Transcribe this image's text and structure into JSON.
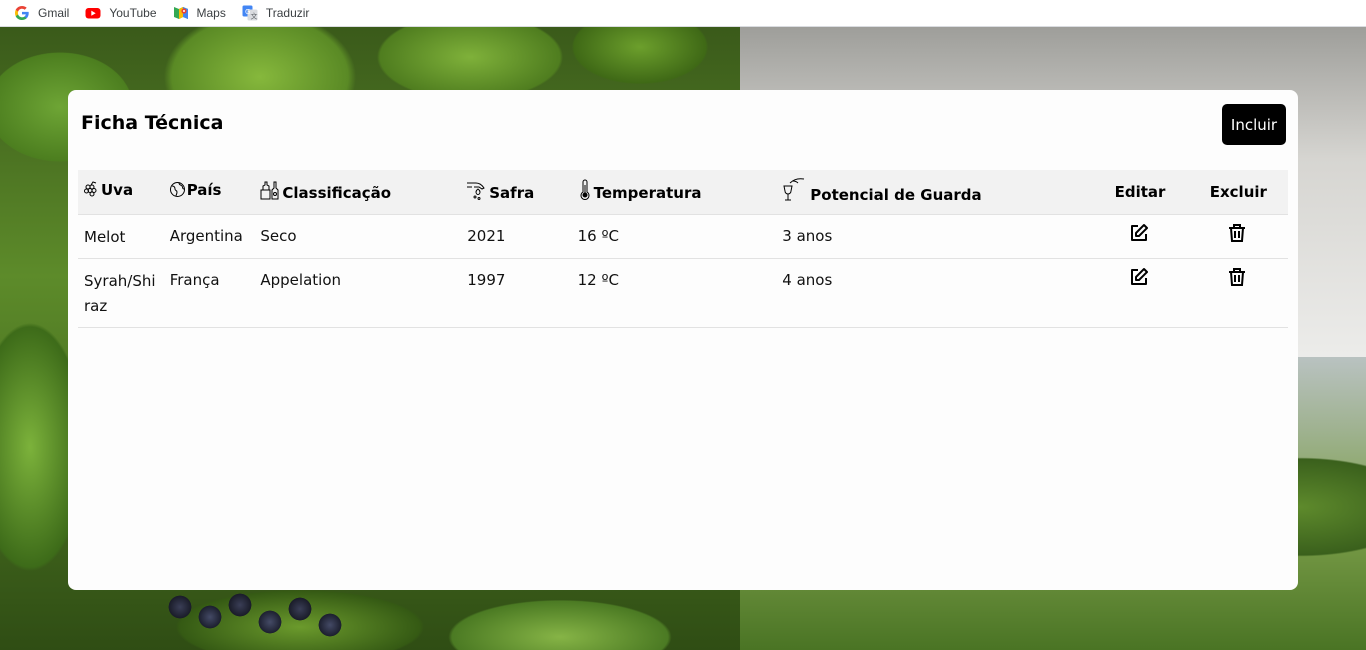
{
  "bookmarks": [
    {
      "label": "Gmail",
      "icon": "google-icon"
    },
    {
      "label": "YouTube",
      "icon": "youtube-icon"
    },
    {
      "label": "Maps",
      "icon": "maps-icon"
    },
    {
      "label": "Traduzir",
      "icon": "translate-icon"
    }
  ],
  "card": {
    "title": "Ficha Técnica",
    "add_button": "Incluir"
  },
  "table": {
    "headers": {
      "uva": "Uva",
      "pais": "País",
      "classificacao": "Classificação",
      "safra": "Safra",
      "temperatura": "Temperatura",
      "potencial": "Potencial de Guarda",
      "editar": "Editar",
      "excluir": "Excluir"
    },
    "header_icons": [
      "grape-icon",
      "globe-icon",
      "wine-bottle-icon",
      "hand-drop-icon",
      "thermometer-icon",
      "wine-glass-icon"
    ],
    "rows": [
      {
        "uva": "Melot",
        "pais": "Argentina",
        "classificacao": "Seco",
        "safra": "2021",
        "temperatura": "16 ºC",
        "potencial": "3 anos"
      },
      {
        "uva": "Syrah/Shiraz",
        "pais": "França",
        "classificacao": "Appelation",
        "safra": "1997",
        "temperatura": "12 ºC",
        "potencial": "4 anos"
      }
    ]
  },
  "colors": {
    "button_bg": "#000000",
    "header_bg": "#f2f2f2",
    "card_bg": "#fdfdfd"
  }
}
